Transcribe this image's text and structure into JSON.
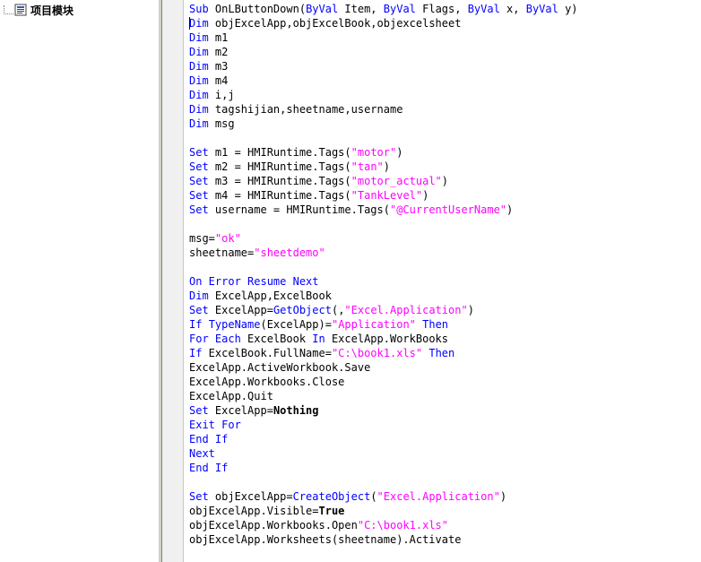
{
  "tree": {
    "root_label": "项目模块"
  },
  "colors": {
    "keyword": "#0000ff",
    "string": "#ff00ff",
    "text": "#000000"
  },
  "code_lines": [
    [
      {
        "t": "Sub",
        "c": "kw"
      },
      {
        "t": " OnLButtonDown("
      },
      {
        "t": "ByVal",
        "c": "kw"
      },
      {
        "t": " Item, "
      },
      {
        "t": "ByVal",
        "c": "kw"
      },
      {
        "t": " Flags, "
      },
      {
        "t": "ByVal",
        "c": "kw"
      },
      {
        "t": " x, "
      },
      {
        "t": "ByVal",
        "c": "kw"
      },
      {
        "t": " y)"
      }
    ],
    [
      {
        "t": "Dim",
        "c": "kw"
      },
      {
        "t": " objExcelApp,objExcelBook,objexcelsheet"
      }
    ],
    [
      {
        "t": "Dim",
        "c": "kw"
      },
      {
        "t": " m1"
      }
    ],
    [
      {
        "t": "Dim",
        "c": "kw"
      },
      {
        "t": " m2"
      }
    ],
    [
      {
        "t": "Dim",
        "c": "kw"
      },
      {
        "t": " m3"
      }
    ],
    [
      {
        "t": "Dim",
        "c": "kw"
      },
      {
        "t": " m4"
      }
    ],
    [
      {
        "t": "Dim",
        "c": "kw"
      },
      {
        "t": " i,j"
      }
    ],
    [
      {
        "t": "Dim",
        "c": "kw"
      },
      {
        "t": " tagshijian,sheetname,username"
      }
    ],
    [
      {
        "t": "Dim",
        "c": "kw"
      },
      {
        "t": " msg"
      }
    ],
    [],
    [
      {
        "t": "Set",
        "c": "kw"
      },
      {
        "t": " m1 = HMIRuntime.Tags("
      },
      {
        "t": "\"motor\"",
        "c": "str"
      },
      {
        "t": ")"
      }
    ],
    [
      {
        "t": "Set",
        "c": "kw"
      },
      {
        "t": " m2 = HMIRuntime.Tags("
      },
      {
        "t": "\"tan\"",
        "c": "str"
      },
      {
        "t": ")"
      }
    ],
    [
      {
        "t": "Set",
        "c": "kw"
      },
      {
        "t": " m3 = HMIRuntime.Tags("
      },
      {
        "t": "\"motor_actual\"",
        "c": "str"
      },
      {
        "t": ")"
      }
    ],
    [
      {
        "t": "Set",
        "c": "kw"
      },
      {
        "t": " m4 = HMIRuntime.Tags("
      },
      {
        "t": "\"TankLevel\"",
        "c": "str"
      },
      {
        "t": ")"
      }
    ],
    [
      {
        "t": "Set",
        "c": "kw"
      },
      {
        "t": " username = HMIRuntime.Tags("
      },
      {
        "t": "\"@CurrentUserName\"",
        "c": "str"
      },
      {
        "t": ")"
      }
    ],
    [],
    [
      {
        "t": "msg="
      },
      {
        "t": "\"ok\"",
        "c": "str"
      }
    ],
    [
      {
        "t": "sheetname="
      },
      {
        "t": "\"sheetdemo\"",
        "c": "str"
      }
    ],
    [],
    [
      {
        "t": "On Error Resume Next",
        "c": "kw"
      }
    ],
    [
      {
        "t": "Dim",
        "c": "kw"
      },
      {
        "t": " ExcelApp,ExcelBook"
      }
    ],
    [
      {
        "t": "Set",
        "c": "kw"
      },
      {
        "t": " ExcelApp="
      },
      {
        "t": "GetObject",
        "c": "fn"
      },
      {
        "t": "(,"
      },
      {
        "t": "\"Excel.Application\"",
        "c": "str"
      },
      {
        "t": ")"
      }
    ],
    [
      {
        "t": "If",
        "c": "kw"
      },
      {
        "t": " "
      },
      {
        "t": "TypeName",
        "c": "fn"
      },
      {
        "t": "(ExcelApp)="
      },
      {
        "t": "\"Application\"",
        "c": "str"
      },
      {
        "t": " "
      },
      {
        "t": "Then",
        "c": "kw"
      }
    ],
    [
      {
        "t": "For Each",
        "c": "kw"
      },
      {
        "t": " ExcelBook "
      },
      {
        "t": "In",
        "c": "kw"
      },
      {
        "t": " ExcelApp.WorkBooks"
      }
    ],
    [
      {
        "t": "If",
        "c": "kw"
      },
      {
        "t": " ExcelBook.FullName="
      },
      {
        "t": "\"C:\\book1.xls\"",
        "c": "str"
      },
      {
        "t": " "
      },
      {
        "t": "Then",
        "c": "kw"
      }
    ],
    [
      {
        "t": "ExcelApp.ActiveWorkbook.Save"
      }
    ],
    [
      {
        "t": "ExcelApp.Workbooks.Close"
      }
    ],
    [
      {
        "t": "ExcelApp.Quit"
      }
    ],
    [
      {
        "t": "Set",
        "c": "kw"
      },
      {
        "t": " ExcelApp="
      },
      {
        "t": "Nothing",
        "c": "bold"
      }
    ],
    [
      {
        "t": "Exit For",
        "c": "kw"
      }
    ],
    [
      {
        "t": "End If",
        "c": "kw"
      }
    ],
    [
      {
        "t": "Next",
        "c": "kw"
      }
    ],
    [
      {
        "t": "End If",
        "c": "kw"
      }
    ],
    [],
    [
      {
        "t": "Set",
        "c": "kw"
      },
      {
        "t": " objExcelApp="
      },
      {
        "t": "CreateObject",
        "c": "fn"
      },
      {
        "t": "("
      },
      {
        "t": "\"Excel.Application\"",
        "c": "str"
      },
      {
        "t": ")"
      }
    ],
    [
      {
        "t": "objExcelApp.Visible="
      },
      {
        "t": "True",
        "c": "bold"
      }
    ],
    [
      {
        "t": "objExcelApp.Workbooks.Open"
      },
      {
        "t": "\"C:\\book1.xls\"",
        "c": "str"
      }
    ],
    [
      {
        "t": "objExcelApp.Worksheets(sheetname).Activate"
      }
    ]
  ]
}
